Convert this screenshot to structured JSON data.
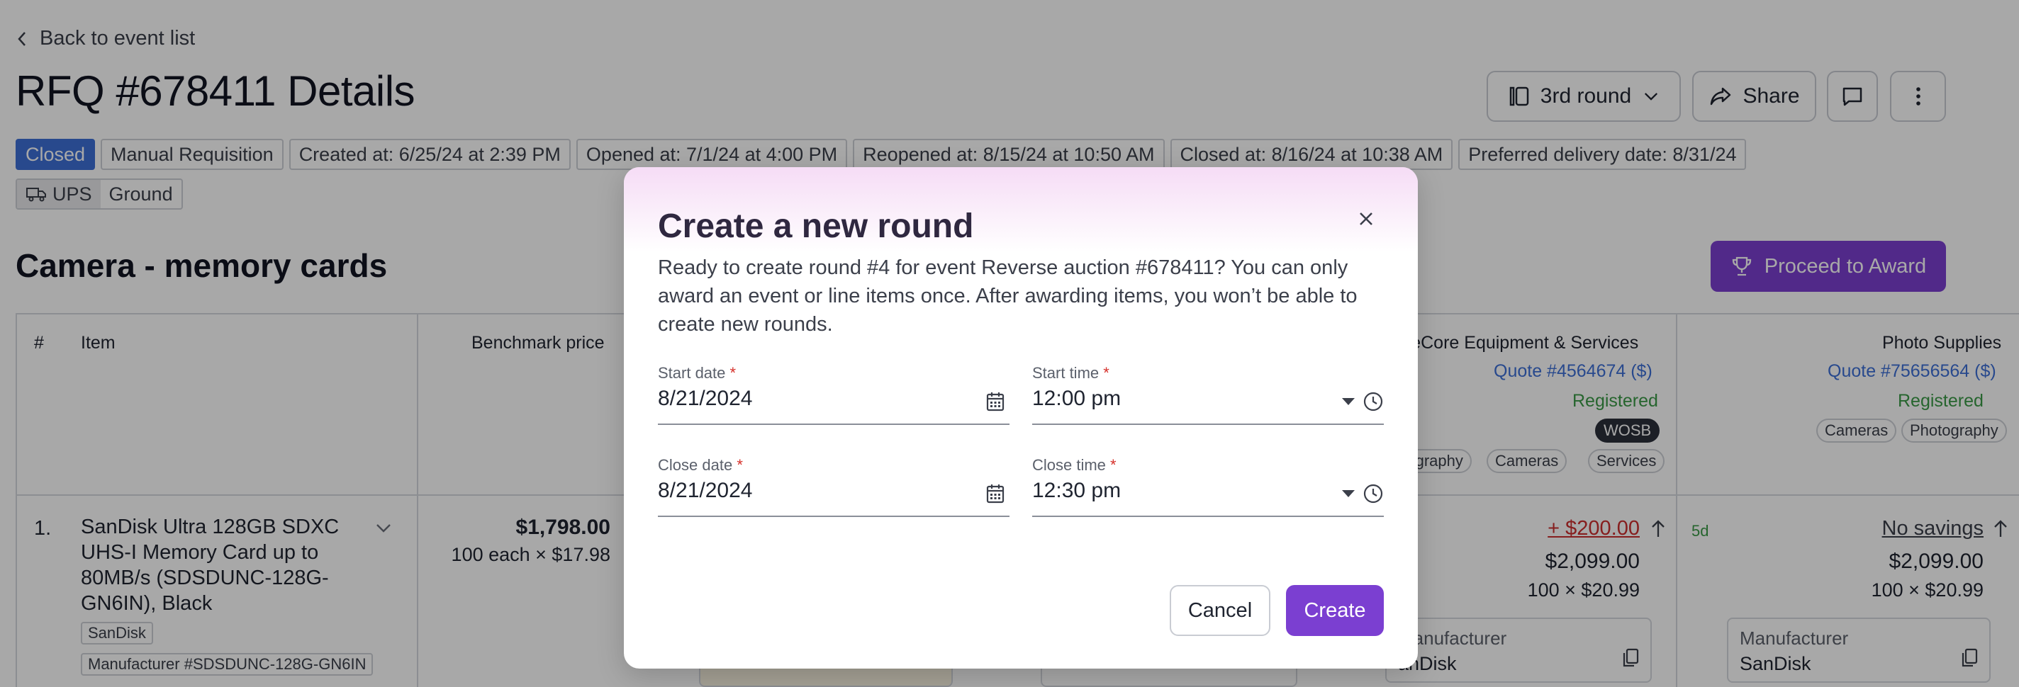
{
  "header": {
    "back_label": "Back to event list",
    "title": "RFQ #678411 Details"
  },
  "toolbar": {
    "round_label": "3rd round",
    "share_label": "Share"
  },
  "status_tags": [
    "Closed",
    "Manual Requisition",
    "Created at: 6/25/24 at 2:39 PM",
    "Opened at: 7/1/24 at 4:00 PM",
    "Reopened at: 8/15/24 at 10:50 AM",
    "Closed at: 8/16/24 at 10:38 AM",
    "Preferred delivery date: 8/31/24"
  ],
  "shipping": {
    "carrier": "UPS",
    "method": "Ground"
  },
  "section": {
    "title": "Camera - memory cards",
    "award_label": "Proceed to Award"
  },
  "table": {
    "headers": {
      "num": "#",
      "item": "Item",
      "benchmark": "Benchmark price"
    },
    "suppliers": [
      {
        "name": "ureCore Equipment & Services",
        "quote": "Quote #4564674 ($)",
        "status": "Registered",
        "badge": "WOSB",
        "tags": [
          "otography",
          "Cameras",
          "Services"
        ],
        "delta": "+ $200.00",
        "total": "$2,099.00",
        "unit": "100 × $20.99",
        "attr_label": "Manufacturer",
        "attr_value": "anDisk"
      },
      {
        "name": "Photo Supplies",
        "quote": "Quote #75656564 ($)",
        "status": "Registered",
        "tags": [
          "Cameras",
          "Photography"
        ],
        "leadtime": "5d",
        "delta": "No savings",
        "total": "$2,099.00",
        "unit": "100 × $20.99",
        "attr_label": "Manufacturer",
        "attr_value": "SanDisk"
      }
    ],
    "row": {
      "num": "1.",
      "name": "SanDisk Ultra 128GB SDXC UHS-I Memory Card up to 80MB/s (SDSDUNC-128G-GN6IN), Black",
      "brand": "SanDisk",
      "mfr": "Manufacturer #SDSDUNC-128G-GN6IN",
      "bench_price": "$1,798.00",
      "bench_sub": "100 each × $17.98"
    }
  },
  "modal": {
    "title": "Create a new round",
    "description": "Ready to create round #4 for event Reverse auction #678411? You can only award an event or line items once. After awarding items, you won’t be able to create new rounds.",
    "start_date_label": "Start date",
    "start_date": "8/21/2024",
    "start_time_label": "Start time",
    "start_time": "12:00 pm",
    "close_date_label": "Close date",
    "close_date": "8/21/2024",
    "close_time_label": "Close time",
    "close_time": "12:30 pm",
    "required_mark": "*",
    "cancel_label": "Cancel",
    "create_label": "Create"
  },
  "colors": {
    "accent": "#7b3fd1",
    "link": "#3d6fd6",
    "success": "#3a9a46",
    "danger": "#cc2e2e",
    "closed_tag": "#3d6fd6"
  },
  "icons": [
    "chevron-left-icon",
    "columns-icon",
    "chevron-down-icon",
    "share-icon",
    "comment-icon",
    "more-vertical-icon",
    "truck-icon",
    "trophy-icon",
    "close-icon",
    "calendar-icon",
    "caret-down-icon",
    "clock-icon",
    "arrow-up-icon",
    "copy-icon"
  ]
}
